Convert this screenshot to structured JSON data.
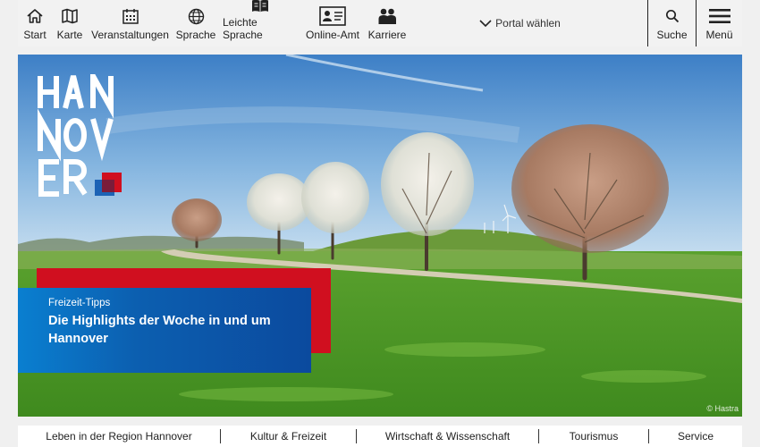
{
  "topnav": {
    "items": [
      {
        "label": "Start",
        "icon": "home-icon"
      },
      {
        "label": "Karte",
        "icon": "map-icon"
      },
      {
        "label": "Veranstaltungen",
        "icon": "calendar-icon"
      },
      {
        "label": "Sprache",
        "icon": "globe-icon"
      },
      {
        "label": "Leichte Sprache",
        "icon": "book-icon"
      },
      {
        "label": "Online-Amt",
        "icon": "id-card-icon"
      },
      {
        "label": "Karriere",
        "icon": "people-icon"
      }
    ],
    "portal_label": "Portal wählen",
    "search_label": "Suche",
    "menu_label": "Menü"
  },
  "hero": {
    "logo_text": [
      "HAN",
      "NOV",
      "ER"
    ],
    "teaser_kicker": "Freizeit-Tipps",
    "teaser_title": "Die Highlights der Woche in und um Hannover",
    "photo_credit": "© Hastra"
  },
  "bottomnav": {
    "items": [
      "Leben in der Region Hannover",
      "Kultur & Freizeit",
      "Wirtschaft & Wissenschaft",
      "Tourismus",
      "Service"
    ]
  },
  "colors": {
    "brand_red": "#d00f1f",
    "brand_blue": "#0b5fb0",
    "sky": "#6ea8d8",
    "grass": "#4f9a2a"
  }
}
